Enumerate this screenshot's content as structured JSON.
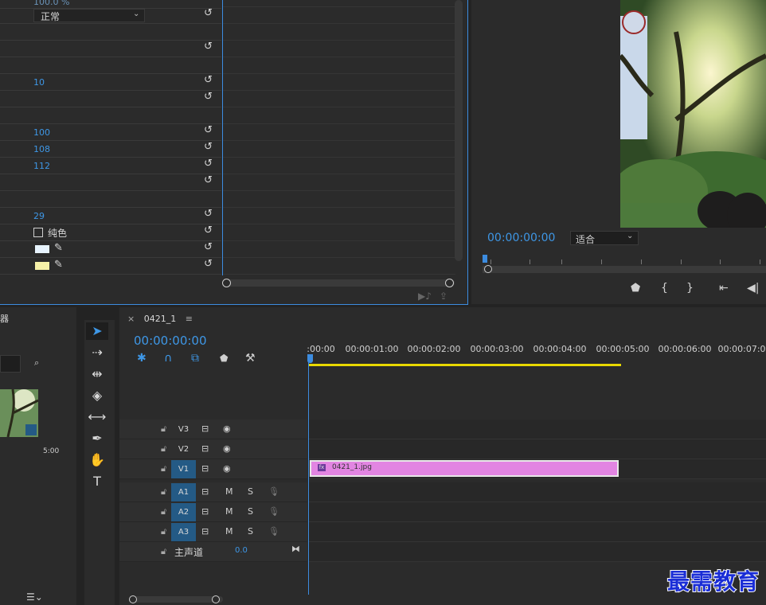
{
  "effect_controls": {
    "top_value": "100.0 %",
    "blend_mode": "正常",
    "rows": [
      {
        "value": ""
      },
      {
        "value": "10"
      },
      {
        "value": ""
      },
      {
        "value": "100"
      },
      {
        "value": "108"
      },
      {
        "value": "112"
      },
      {
        "value": ""
      },
      {
        "value": "29"
      }
    ],
    "solid_color_label": "纯色",
    "swatch1_color": "#e8f4ff",
    "swatch2_color": "#f6f1a8"
  },
  "program_monitor": {
    "timecode": "00:00:00:00",
    "fit_option": "适合"
  },
  "timeline": {
    "tab_label": "0421_1",
    "timecode": "00:00:00:00",
    "ruler_labels": [
      ":00:00",
      "00:00:01:00",
      "00:00:02:00",
      "00:00:03:00",
      "00:00:04:00",
      "00:00:05:00",
      "00:00:06:00",
      "00:00:07:00"
    ],
    "video_tracks": [
      "V3",
      "V2",
      "V1"
    ],
    "audio_tracks": [
      "A1",
      "A2",
      "A3"
    ],
    "mute_label": "M",
    "solo_label": "S",
    "master_label": "主声道",
    "master_value": "0.0",
    "clip_name": "0421_1.jpg"
  },
  "project": {
    "header_char": "器",
    "thumb_duration": "5:00"
  },
  "watermark": "最需教育"
}
